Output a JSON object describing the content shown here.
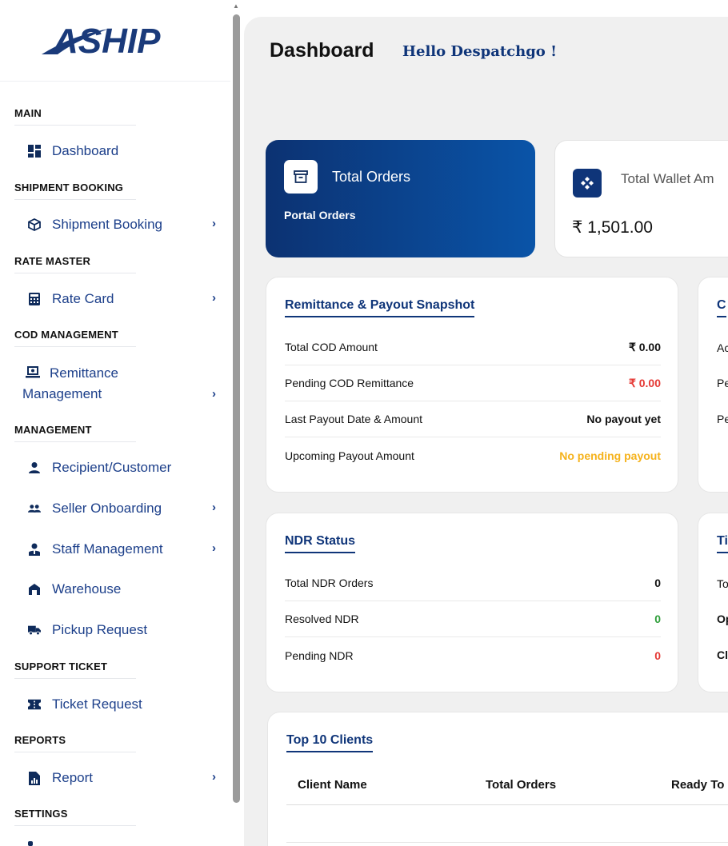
{
  "brand": {
    "logo_text": "ASHIP"
  },
  "sidebar": {
    "sections": {
      "main": "MAIN",
      "shipment_booking": "SHIPMENT BOOKING",
      "rate_master": "RATE MASTER",
      "cod_management": "COD MANAGEMENT",
      "management": "MANAGEMENT",
      "support_ticket": "SUPPORT TICKET",
      "reports": "REPORTS",
      "settings": "SETTINGS"
    },
    "items": {
      "dashboard": "Dashboard",
      "shipment_booking": "Shipment Booking",
      "rate_card": "Rate Card",
      "remittance_line1": "Remittance",
      "remittance_line2": "Management",
      "recipient": "Recipient/Customer",
      "seller_onboarding": "Seller Onboarding",
      "staff_management": "Staff Management",
      "warehouse": "Warehouse",
      "pickup_request": "Pickup Request",
      "ticket_request": "Ticket Request",
      "report": "Report"
    },
    "chevron": "›"
  },
  "header": {
    "title": "Dashboard",
    "greeting": "Hello Despatchgo !"
  },
  "cards": {
    "total_orders": {
      "title": "Total Orders",
      "subtitle": "Portal Orders"
    },
    "wallet": {
      "title": "Total Wallet Am",
      "value": "₹ 1,501.00"
    }
  },
  "remittance": {
    "title": "Remittance & Payout Snapshot",
    "rows": [
      {
        "label": "Total COD Amount",
        "value": "₹ 0.00"
      },
      {
        "label": "Pending COD Remittance",
        "value": "₹ 0.00"
      },
      {
        "label": "Last Payout Date & Amount",
        "value": "No payout yet"
      },
      {
        "label": "Upcoming Payout Amount",
        "value": "No pending payout"
      }
    ]
  },
  "cod_partial": {
    "title": "C",
    "rows": [
      "Ac",
      "Pe",
      "Pe"
    ]
  },
  "ndr": {
    "title": "NDR Status",
    "rows": [
      {
        "label": "Total NDR Orders",
        "value": "0"
      },
      {
        "label": "Resolved NDR",
        "value": "0"
      },
      {
        "label": "Pending NDR",
        "value": "0"
      }
    ]
  },
  "ticket_partial": {
    "title": "Ti",
    "rows": [
      "To",
      "Op",
      "Cl"
    ]
  },
  "top_clients": {
    "title": "Top 10 Clients",
    "columns": [
      "Client Name",
      "Total Orders",
      "Ready To"
    ]
  },
  "colors": {
    "primary": "#0f3579",
    "danger": "#e53935",
    "success": "#2e9e3a",
    "warning": "#f5b21b"
  }
}
